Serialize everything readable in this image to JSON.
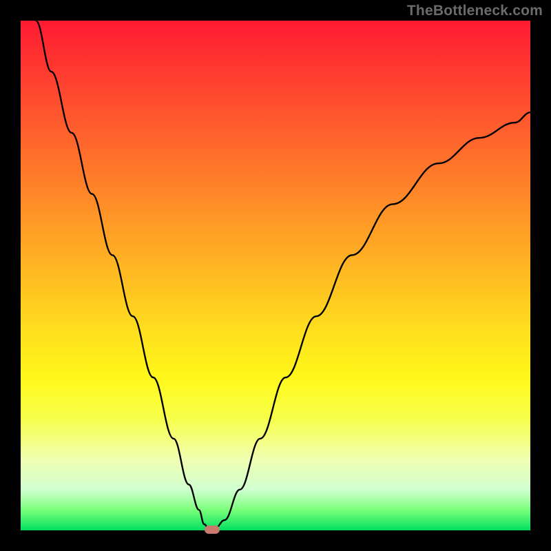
{
  "watermark": "TheBottleneck.com",
  "chart_data": {
    "type": "line",
    "title": "",
    "xlabel": "",
    "ylabel": "",
    "xlim": [
      0,
      100
    ],
    "ylim": [
      0,
      100
    ],
    "series": [
      {
        "name": "curve",
        "x": [
          3,
          6,
          10,
          14,
          18,
          22,
          26,
          30,
          33,
          35,
          36,
          37,
          38,
          40,
          43,
          47,
          52,
          58,
          65,
          73,
          82,
          90,
          97,
          100
        ],
        "y": [
          100,
          90,
          78,
          66,
          54,
          42,
          30,
          18,
          9,
          4,
          1.2,
          0.2,
          0.2,
          2,
          8,
          18,
          30,
          42,
          54,
          64,
          72,
          77,
          80,
          82
        ]
      }
    ],
    "marker": {
      "x": 37.5,
      "y": 0.2,
      "color": "#c97a6c"
    },
    "background_gradient": {
      "stops": [
        {
          "pos": 0,
          "color": "#ff1a32"
        },
        {
          "pos": 50,
          "color": "#ffdc1e"
        },
        {
          "pos": 100,
          "color": "#00e060"
        }
      ]
    }
  }
}
